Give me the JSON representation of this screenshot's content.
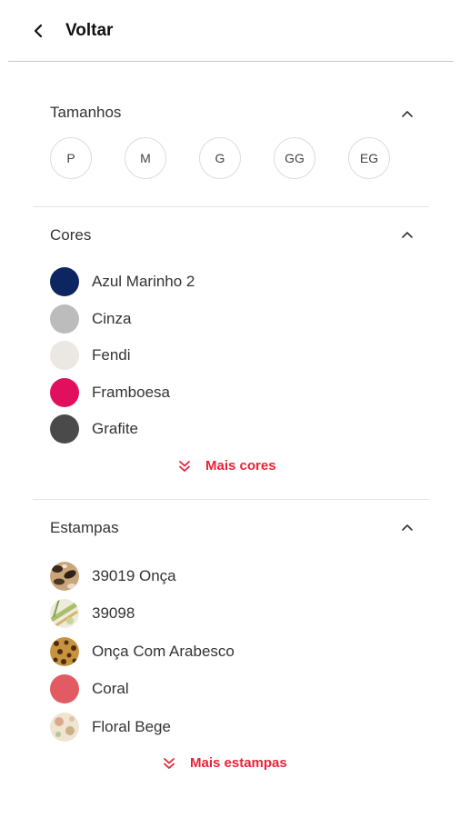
{
  "header": {
    "back_label": "Voltar"
  },
  "sizes_section": {
    "title": "Tamanhos",
    "sizes": [
      "P",
      "M",
      "G",
      "GG",
      "EG"
    ]
  },
  "colors_section": {
    "title": "Cores",
    "items": [
      {
        "label": "Azul Marinho 2",
        "color": "#0d2561"
      },
      {
        "label": "Cinza",
        "color": "#bcbcbc"
      },
      {
        "label": "Fendi",
        "color": "#ebe7e3"
      },
      {
        "label": "Framboesa",
        "color": "#e0105f"
      },
      {
        "label": "Grafite",
        "color": "#4a4a4a"
      }
    ],
    "more_label": "Mais cores"
  },
  "prints_section": {
    "title": "Estampas",
    "items": [
      {
        "label": "39019 Onça"
      },
      {
        "label": "39098"
      },
      {
        "label": "Onça Com Arabesco"
      },
      {
        "label": "Coral"
      },
      {
        "label": "Floral Bege"
      }
    ],
    "more_label": "Mais estampas"
  },
  "colors": {
    "accent": "#e8233a"
  }
}
